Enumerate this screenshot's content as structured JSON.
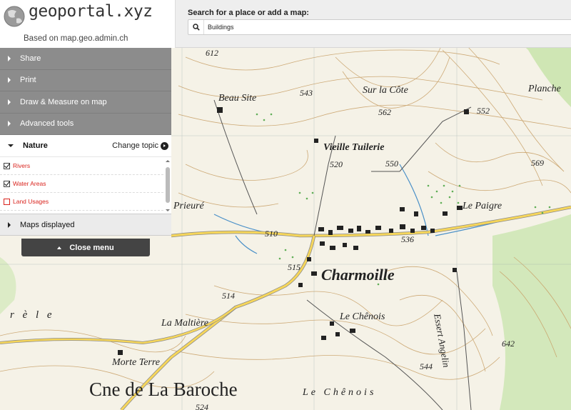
{
  "app": {
    "brand": "geoportal.xyz",
    "subtitle": "Based on map.geo.admin.ch"
  },
  "search": {
    "label": "Search for a place or add a map:",
    "value": "Buildings",
    "icon": "search-icon"
  },
  "menu": {
    "items": [
      {
        "label": "Share"
      },
      {
        "label": "Print"
      },
      {
        "label": "Draw & Measure on map"
      },
      {
        "label": "Advanced tools"
      }
    ],
    "topic": {
      "title": "Nature",
      "change_label": "Change topic"
    },
    "layers": [
      {
        "label": "Rivers",
        "checked": true
      },
      {
        "label": "Water Areas",
        "checked": true
      },
      {
        "label": "Land Usages",
        "checked": false
      }
    ],
    "maps_displayed_label": "Maps displayed",
    "close_label": "Close menu"
  },
  "map": {
    "places": [
      {
        "name": "Charmoille"
      },
      {
        "name": "Cne de La Baroche"
      },
      {
        "name": "Beau Site"
      },
      {
        "name": "Sur la Côte"
      },
      {
        "name": "Vieille Tuilerie"
      },
      {
        "name": "Le Paigre"
      },
      {
        "name": "Prieuré"
      },
      {
        "name": "Le Chênois"
      },
      {
        "name": "La Maltière"
      },
      {
        "name": "Morte Terre"
      },
      {
        "name": "Planche"
      },
      {
        "name": "Essert Angelin"
      },
      {
        "name": "Le Chênois"
      },
      {
        "name": "r è l e"
      }
    ],
    "elevations": [
      "543",
      "562",
      "552",
      "550",
      "520",
      "569",
      "510",
      "536",
      "515",
      "514",
      "544",
      "642",
      "612",
      "524"
    ]
  }
}
